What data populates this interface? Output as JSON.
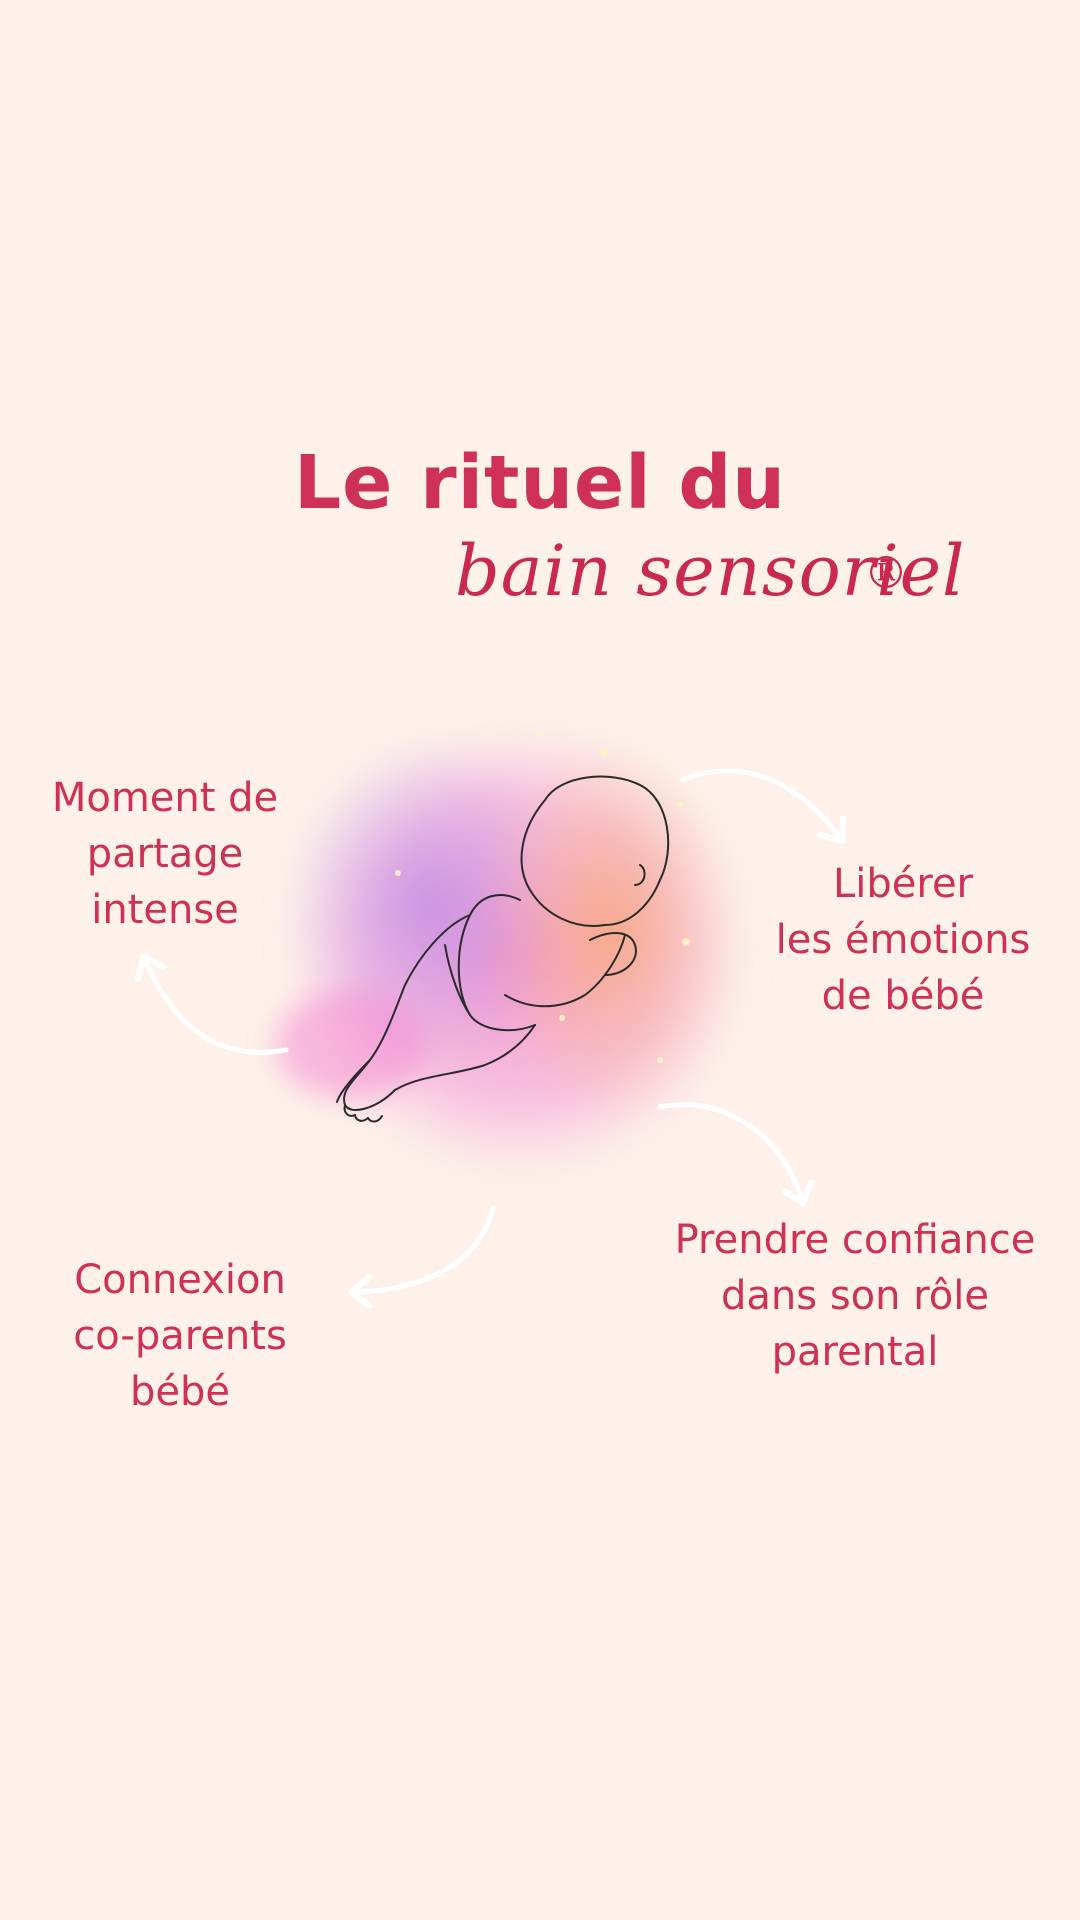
{
  "title": {
    "line1": "Le rituel du",
    "line2": "bain sensoriel",
    "mark": "®"
  },
  "benefits": [
    {
      "lines": [
        "Moment de",
        "partage",
        "intense"
      ]
    },
    {
      "lines": [
        "Libérer",
        "les émotions",
        "de bébé"
      ]
    },
    {
      "lines": [
        "Connexion",
        "co-parents",
        "bébé"
      ]
    },
    {
      "lines": [
        "Prendre confiance",
        "dans son rôle",
        "parental"
      ]
    }
  ],
  "illustration": {
    "icon": "sleeping-baby-icon",
    "palette": {
      "pink": "#f07cc8",
      "violet": "#b98ae6",
      "orange": "#f7a878",
      "arrow": "#ffffff",
      "line": "#2a2a2a"
    }
  },
  "colors": {
    "background": "#fdf1e9",
    "text": "#cf3058"
  }
}
